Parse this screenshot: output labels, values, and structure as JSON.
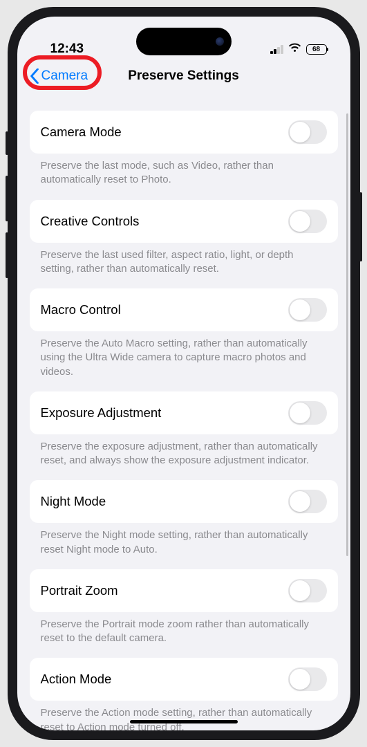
{
  "status": {
    "time": "12:43",
    "battery": "68"
  },
  "nav": {
    "back_label": "Camera",
    "title": "Preserve Settings"
  },
  "settings": [
    {
      "label": "Camera Mode",
      "desc": "Preserve the last mode, such as Video, rather than automatically reset to Photo.",
      "on": false
    },
    {
      "label": "Creative Controls",
      "desc": "Preserve the last used filter, aspect ratio, light, or depth setting, rather than automatically reset.",
      "on": false
    },
    {
      "label": "Macro Control",
      "desc": "Preserve the Auto Macro setting, rather than automatically using the Ultra Wide camera to capture macro photos and videos.",
      "on": false
    },
    {
      "label": "Exposure Adjustment",
      "desc": "Preserve the exposure adjustment, rather than automatically reset, and always show the exposure adjustment indicator.",
      "on": false
    },
    {
      "label": "Night Mode",
      "desc": "Preserve the Night mode setting, rather than automatically reset Night mode to Auto.",
      "on": false
    },
    {
      "label": "Portrait Zoom",
      "desc": "Preserve the Portrait mode zoom rather than automatically reset to the default camera.",
      "on": false
    },
    {
      "label": "Action Mode",
      "desc": "Preserve the Action mode setting, rather than automatically reset to Action mode turned off.",
      "on": false
    }
  ],
  "annotation": {
    "highlight_back": true
  }
}
